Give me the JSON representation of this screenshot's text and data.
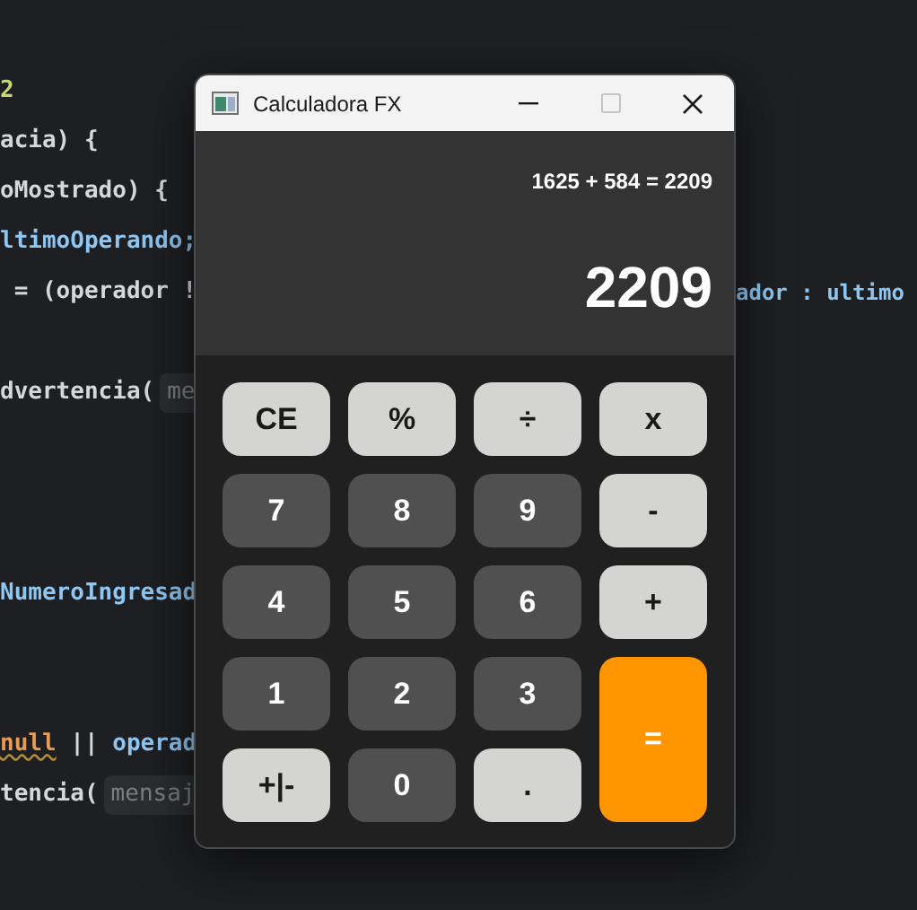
{
  "editor": {
    "lines": [
      {
        "kind": "code",
        "segments": [
          {
            "kind": "number",
            "text": "2"
          }
        ]
      },
      {
        "kind": "code",
        "segments": [
          {
            "kind": "plain",
            "text": "acia) {"
          }
        ]
      },
      {
        "kind": "code",
        "segments": [
          {
            "kind": "plain",
            "text": "oMostrado) {"
          }
        ]
      },
      {
        "kind": "code",
        "segments": [
          {
            "kind": "identifier",
            "text": "ltimoOperando;"
          }
        ]
      },
      {
        "kind": "code",
        "segments": [
          {
            "kind": "plain",
            "text": " = (operador !"
          }
        ],
        "right": "ador : ultimo"
      },
      {
        "kind": "blank"
      },
      {
        "kind": "code",
        "segments": [
          {
            "kind": "plain",
            "text": "dvertencia("
          }
        ],
        "hint": "me"
      },
      {
        "kind": "blank"
      },
      {
        "kind": "blank"
      },
      {
        "kind": "blank"
      },
      {
        "kind": "code",
        "segments": [
          {
            "kind": "identifier",
            "text": "NumeroIngresad"
          }
        ]
      },
      {
        "kind": "blank"
      },
      {
        "kind": "blank"
      },
      {
        "kind": "code",
        "segments": [
          {
            "kind": "keyword",
            "text": "null"
          },
          {
            "kind": "plain",
            "text": " || "
          },
          {
            "kind": "identifier",
            "text": "operad"
          }
        ]
      },
      {
        "kind": "code",
        "segments": [
          {
            "kind": "plain",
            "text": "tencia("
          }
        ],
        "hint": "mensaj"
      }
    ]
  },
  "window": {
    "title": "Calculadora FX",
    "controls": [
      {
        "kind": "minimize",
        "disabled": false
      },
      {
        "kind": "maximize",
        "disabled": true
      },
      {
        "kind": "close",
        "disabled": false
      }
    ],
    "display": {
      "expression": "1625 + 584 = 2209",
      "result": "2209"
    },
    "keys": [
      {
        "label": "CE",
        "kind": "light",
        "tall": false
      },
      {
        "label": "%",
        "kind": "light",
        "tall": false
      },
      {
        "label": "÷",
        "kind": "light",
        "tall": false
      },
      {
        "label": "x",
        "kind": "light",
        "tall": false
      },
      {
        "label": "7",
        "kind": "dark",
        "tall": false
      },
      {
        "label": "8",
        "kind": "dark",
        "tall": false
      },
      {
        "label": "9",
        "kind": "dark",
        "tall": false
      },
      {
        "label": "-",
        "kind": "light",
        "tall": false
      },
      {
        "label": "4",
        "kind": "dark",
        "tall": false
      },
      {
        "label": "5",
        "kind": "dark",
        "tall": false
      },
      {
        "label": "6",
        "kind": "dark",
        "tall": false
      },
      {
        "label": "+",
        "kind": "light",
        "tall": false
      },
      {
        "label": "1",
        "kind": "dark",
        "tall": false
      },
      {
        "label": "2",
        "kind": "dark",
        "tall": false
      },
      {
        "label": "3",
        "kind": "dark",
        "tall": false
      },
      {
        "label": "=",
        "kind": "accent",
        "tall": true
      },
      {
        "label": "+|-",
        "kind": "light",
        "tall": false
      },
      {
        "label": "0",
        "kind": "dark",
        "tall": false
      },
      {
        "label": ".",
        "kind": "light",
        "tall": false
      }
    ]
  }
}
